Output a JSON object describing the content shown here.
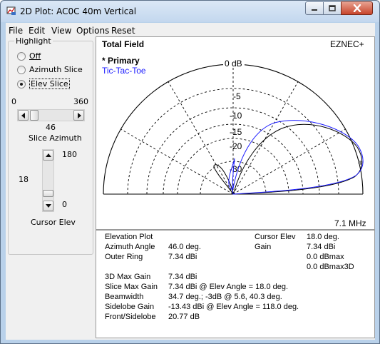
{
  "window": {
    "title": "2D Plot: AC0C 40m Vertical",
    "minimize_icon": "minimize-icon",
    "maximize_icon": "maximize-icon",
    "close_icon": "close-icon"
  },
  "menu": [
    "File",
    "Edit",
    "View",
    "Options",
    "Reset"
  ],
  "highlight": {
    "group_label": "Highlight",
    "options": [
      {
        "label": "Off",
        "selected": false
      },
      {
        "label": "Azimuth Slice",
        "selected": false
      },
      {
        "label": "Elev Slice",
        "selected": true
      }
    ],
    "slice_min": "0",
    "slice_max": "360",
    "slice_value": "46",
    "slice_label": "Slice Azimuth",
    "elev_max": "180",
    "elev_value": "18",
    "elev_min": "0",
    "elev_label": "Cursor Elev"
  },
  "plot": {
    "title": "Total Field",
    "brand": "EZNEC+",
    "legend_primary": "* Primary",
    "legend_secondary": "Tic-Tac-Toe",
    "frequency": "7.1 MHz",
    "ring_labels": [
      "0 dB",
      "-5",
      "-10",
      "-15",
      "-20",
      "-30"
    ],
    "colors": {
      "primary": "#000000",
      "secondary": "#1a1aff",
      "grid": "#000000"
    }
  },
  "info": {
    "rows": [
      {
        "label": "Elevation Plot",
        "value": ""
      },
      {
        "label": "Azimuth Angle",
        "value": "46.0 deg."
      },
      {
        "label": "Outer Ring",
        "value": "7.34 dBi"
      },
      {
        "label": "3D Max Gain",
        "value": "7.34 dBi"
      },
      {
        "label": "Slice Max Gain",
        "value": "7.34 dBi @ Elev Angle = 18.0 deg."
      },
      {
        "label": "Beamwidth",
        "value": "34.7 deg.; -3dB @ 5.6, 40.3 deg."
      },
      {
        "label": "Sidelobe Gain",
        "value": "-13.43 dBi @ Elev Angle = 118.0 deg."
      },
      {
        "label": "Front/Sidelobe",
        "value": "20.77 dB"
      }
    ],
    "cursor": {
      "elev_label": "Cursor Elev",
      "elev_value": "18.0 deg.",
      "gain_label": "Gain",
      "gain_value": "7.34 dBi",
      "dbmax": "0.0 dBmax",
      "dbmax3d": "0.0 dBmax3D"
    }
  }
}
